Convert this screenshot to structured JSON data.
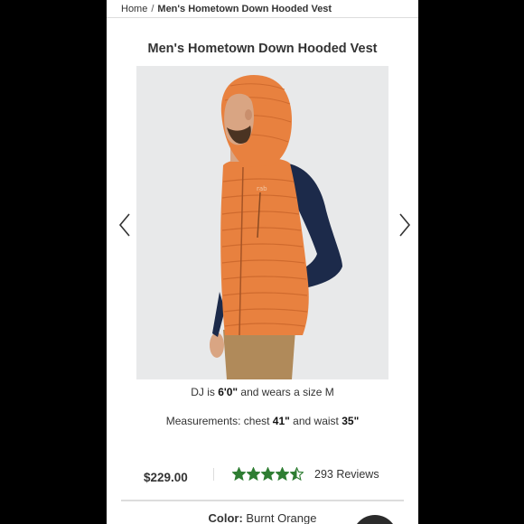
{
  "breadcrumb": {
    "home": "Home",
    "separator": "/",
    "current": "Men's Hometown Down Hooded Vest"
  },
  "product": {
    "title": "Men's Hometown Down Hooded Vest",
    "image_alt": "Man wearing orange hooded down vest",
    "fit_note": {
      "prefix": "DJ is ",
      "height": "6'0\"",
      "middle": " and wears a size ",
      "size": "M"
    },
    "measurements": {
      "prefix": "Measurements: chest ",
      "chest": "41\"",
      "middle": " and waist ",
      "waist": "35\""
    },
    "price": "$229.00",
    "rating": 4.5,
    "rating_max": 5,
    "reviews": "293 Reviews",
    "color": {
      "label": "Color:",
      "value": "Burnt Orange"
    }
  },
  "icons": {
    "prev": "chevron-left-icon",
    "next": "chevron-right-icon",
    "star": "star-icon",
    "chat": "chat-icon"
  },
  "colors": {
    "star": "#2e7d32",
    "vest": "#e8813f",
    "photo_bg": "#e8e9ea",
    "divider": "#dddddd"
  }
}
